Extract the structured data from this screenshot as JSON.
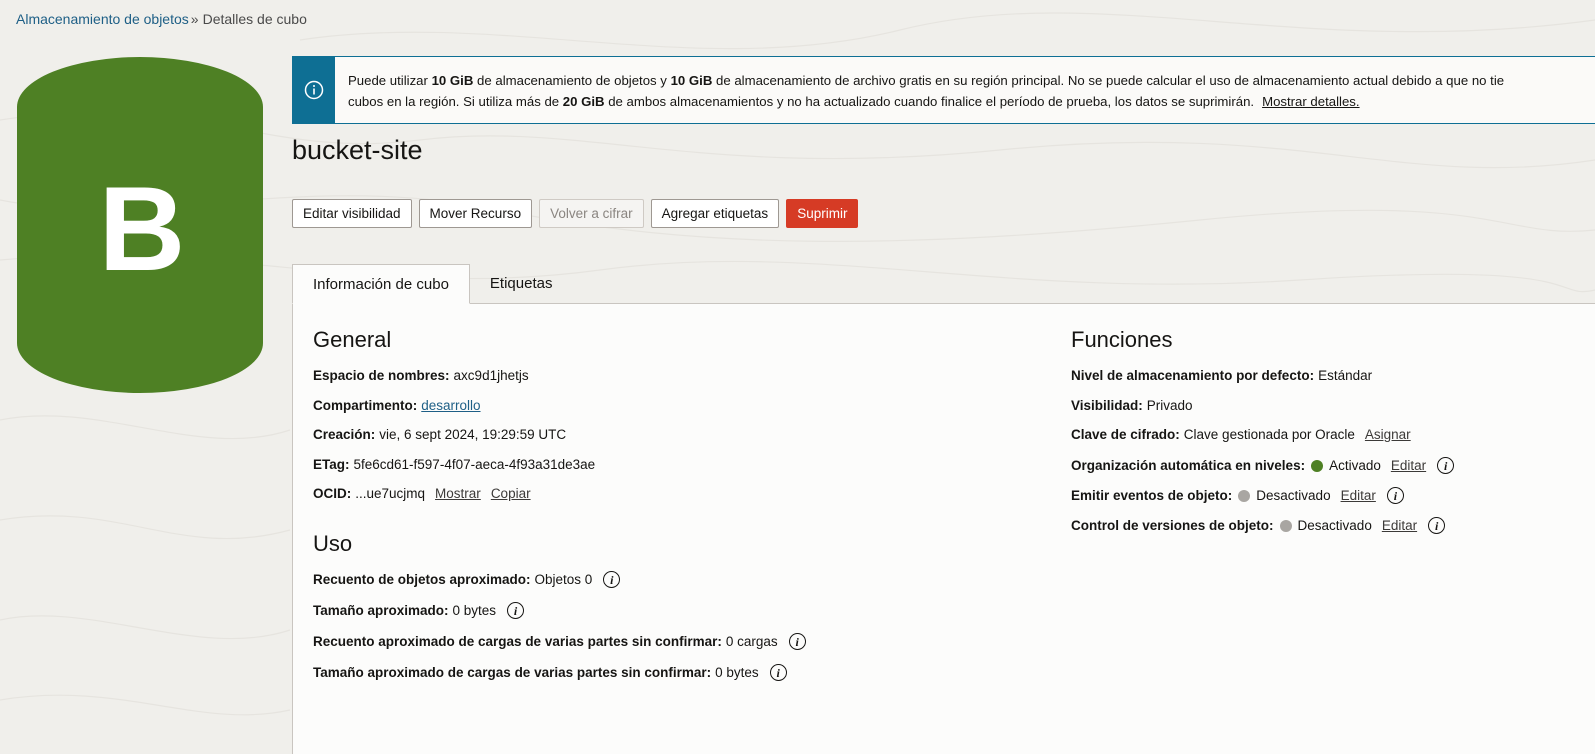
{
  "breadcrumb": {
    "parent": "Almacenamiento de objetos",
    "separator": "»",
    "current": "Detalles de cubo"
  },
  "bucket_icon": {
    "letter": "B",
    "color": "#4e8024"
  },
  "banner": {
    "t1": "Puede utilizar ",
    "b1": "10 GiB",
    "t2": " de almacenamiento de objetos y ",
    "b2": "10 GiB",
    "t3": " de almacenamiento de archivo gratis en su región principal. No se puede calcular el uso de almacenamiento actual debido a que no tie",
    "t4": "cubos en la región. Si utiliza más de ",
    "b3": "20 GiB",
    "t5": " de ambos almacenamientos y no ha actualizado cuando finalice el período de prueba, los datos se suprimirán.",
    "link": "Mostrar detalles.",
    "accent": "#0e6f94"
  },
  "title": "bucket-site",
  "toolbar": {
    "edit_visibility": "Editar visibilidad",
    "move_resource": "Mover Recurso",
    "reencrypt": "Volver a cifrar",
    "add_tags": "Agregar etiquetas",
    "delete": "Suprimir"
  },
  "tabs": {
    "info": "Información de cubo",
    "tags": "Etiquetas"
  },
  "general": {
    "title": "General",
    "namespace_label": "Espacio de nombres:",
    "namespace": "axc9d1jhetjs",
    "compartment_label": "Compartimento:",
    "compartment": "desarrollo",
    "created_label": "Creación:",
    "created": "vie, 6 sept 2024, 19:29:59 UTC",
    "etag_label": "ETag:",
    "etag": "5fe6cd61-f597-4f07-aeca-4f93a31de3ae",
    "ocid_label": "OCID:",
    "ocid": "...ue7ucjmq",
    "show": "Mostrar",
    "copy": "Copiar"
  },
  "usage": {
    "title": "Uso",
    "object_count_label": "Recuento de objetos aproximado:",
    "object_count": "Objetos 0",
    "size_label": "Tamaño aproximado:",
    "size": "0 bytes",
    "uploads_count_label": "Recuento aproximado de cargas de varias partes sin confirmar:",
    "uploads_count": "0 cargas",
    "uploads_size_label": "Tamaño aproximado de cargas de varias partes sin confirmar:",
    "uploads_size": "0 bytes"
  },
  "features": {
    "title": "Funciones",
    "tier_label": "Nivel de almacenamiento por defecto:",
    "tier": "Estándar",
    "visibility_label": "Visibilidad:",
    "visibility": "Privado",
    "key_label": "Clave de cifrado:",
    "key": "Clave gestionada por Oracle",
    "assign": "Asignar",
    "autotier_label": "Organización automática en niveles:",
    "autotier": "Activado",
    "events_label": "Emitir eventos de objeto:",
    "events": "Desactivado",
    "versioning_label": "Control de versiones de objeto:",
    "versioning": "Desactivado",
    "edit": "Editar",
    "on_color": "#4e8024",
    "off_color": "#a9a6a2"
  },
  "info_glyph": "i"
}
